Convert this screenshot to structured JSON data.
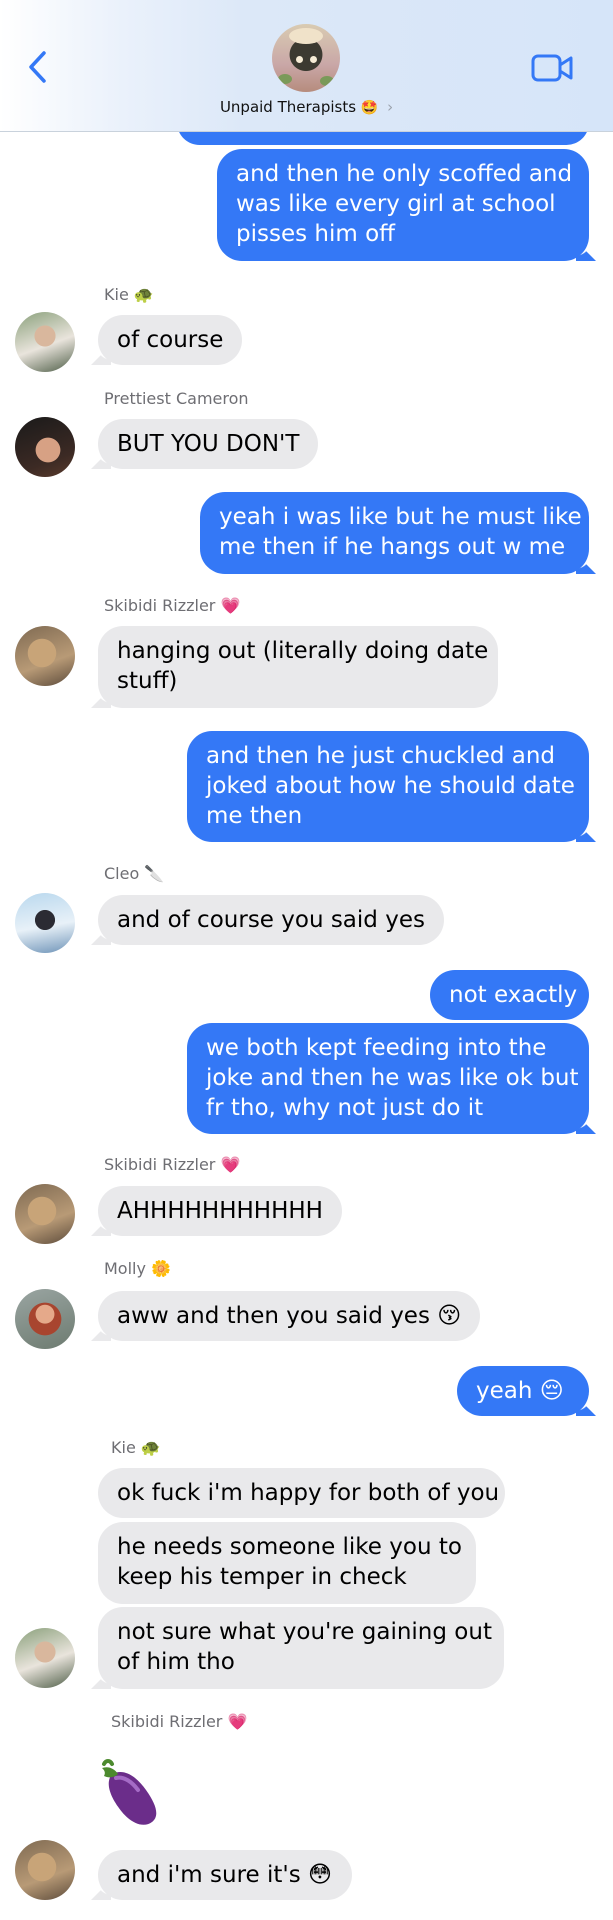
{
  "header": {
    "title": "Unpaid Therapists",
    "title_emoji": "🤩",
    "chevron": "›"
  },
  "messages": {
    "m1": "and then he only scoffed and\nwas like every girl at school\npisses him off",
    "kie1_sender": "Kie 🐢",
    "kie1": "of course",
    "cam_sender": "Prettiest Cameron",
    "cam": "BUT YOU DON'T",
    "m2": "yeah i was like but he must like\nme then if he hangs out w me",
    "skib1_sender": "Skibidi Rizzler 💗",
    "skib1": "hanging out (literally doing date\nstuff)",
    "m3": "and then he just chuckled and\njoked about how he should date\nme then",
    "cleo_sender": "Cleo 🔪",
    "cleo": "and of course you said yes",
    "m4": "not exactly",
    "m5": "we both kept feeding into the\njoke and then he was like ok but\nfr tho, why not just do it",
    "skib2_sender": "Skibidi Rizzler 💗",
    "skib2": "AHHHHHHHHHHH",
    "molly_sender": "Molly 🌼",
    "molly": "aww and then you said yes 😚",
    "m6": "yeah 😔",
    "kie2_sender": "Kie 🐢",
    "kie2a": "ok fuck i'm happy for both of you",
    "kie2b": "he needs someone like you to\nkeep his temper in check",
    "kie2c": "not sure what you're gaining out\nof him tho",
    "skib3_sender": "Skibidi Rizzler 💗",
    "skib3_emoji": "🍆",
    "skib3": "and i'm sure it's 😳"
  },
  "colors": {
    "outgoing": "#3478f6",
    "incoming": "#e9e9eb",
    "header_accent": "#3478f6"
  },
  "icons": [
    "back-chevron-icon",
    "video-call-icon",
    "group-avatar",
    "eggplant-icon"
  ]
}
